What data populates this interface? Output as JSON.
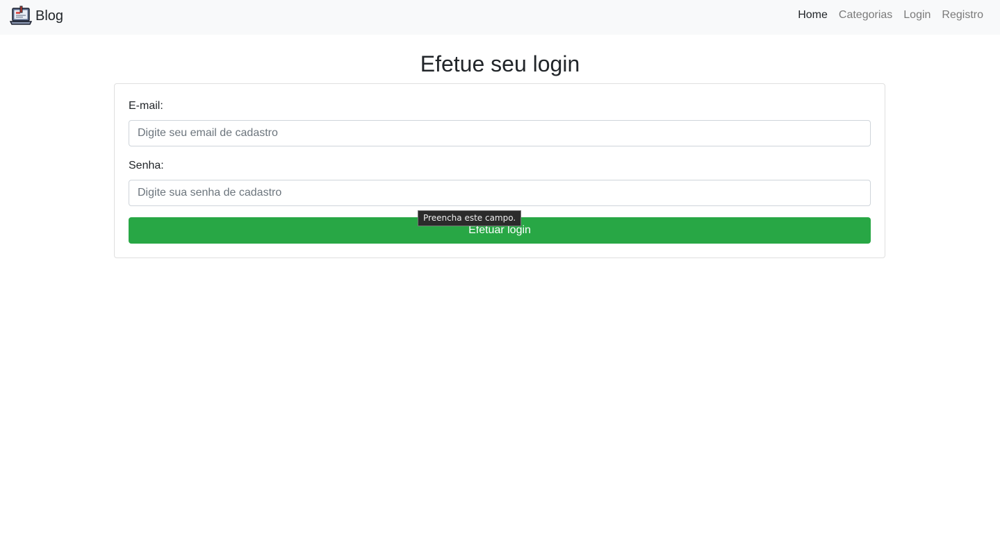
{
  "navbar": {
    "brand": "Blog",
    "brand_icon": "laptop-icon",
    "links": [
      {
        "label": "Home",
        "active": true
      },
      {
        "label": "Categorias",
        "active": false
      },
      {
        "label": "Login",
        "active": false
      },
      {
        "label": "Registro",
        "active": false
      }
    ]
  },
  "page": {
    "title": "Efetue seu login"
  },
  "form": {
    "email_label": "E-mail:",
    "email_placeholder": "Digite seu email de cadastro",
    "email_value": "",
    "password_label": "Senha:",
    "password_placeholder": "Digite sua senha de cadastro",
    "password_value": "",
    "submit_label": "Efetuar login"
  },
  "validation_tooltip": {
    "text": "Preencha este campo."
  },
  "colors": {
    "navbar_bg": "#f8f9fa",
    "button_success": "#28a745",
    "tooltip_bg": "#2b2b2b"
  }
}
